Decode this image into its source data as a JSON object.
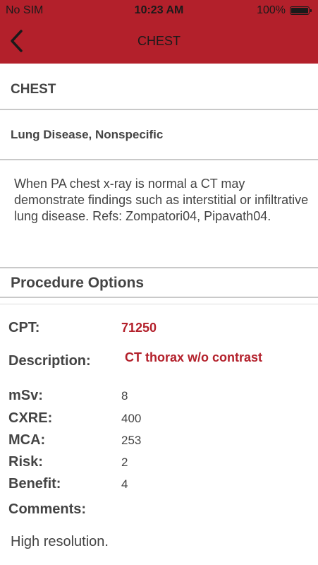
{
  "status_bar": {
    "carrier": "No SIM",
    "time": "10:23 AM",
    "battery": "100%"
  },
  "nav": {
    "title": "CHEST",
    "back_icon": "chevron-left-icon"
  },
  "colors": {
    "header": "#b3202b",
    "accent": "#b3202b"
  },
  "section": {
    "title": "CHEST"
  },
  "subsection": {
    "title": "Lung Disease, Nonspecific"
  },
  "description": "When PA chest x-ray is normal a CT may demonstrate findings such as interstitial or infiltrative lung disease. Refs: Zompatori04, Pipavath04.",
  "procedure": {
    "title": "Procedure Options",
    "cpt_label": "CPT:",
    "cpt_value": "71250",
    "description_label": "Description:",
    "description_value": "CT thorax w/o contrast",
    "msv_label": "mSv:",
    "msv_value": "8",
    "cxre_label": "CXRE:",
    "cxre_value": "400",
    "mca_label": "MCA:",
    "mca_value": "253",
    "risk_label": "Risk:",
    "risk_value": "2",
    "benefit_label": "Benefit:",
    "benefit_value": "4",
    "comments_label": "Comments:",
    "comments_value": "High resolution."
  }
}
